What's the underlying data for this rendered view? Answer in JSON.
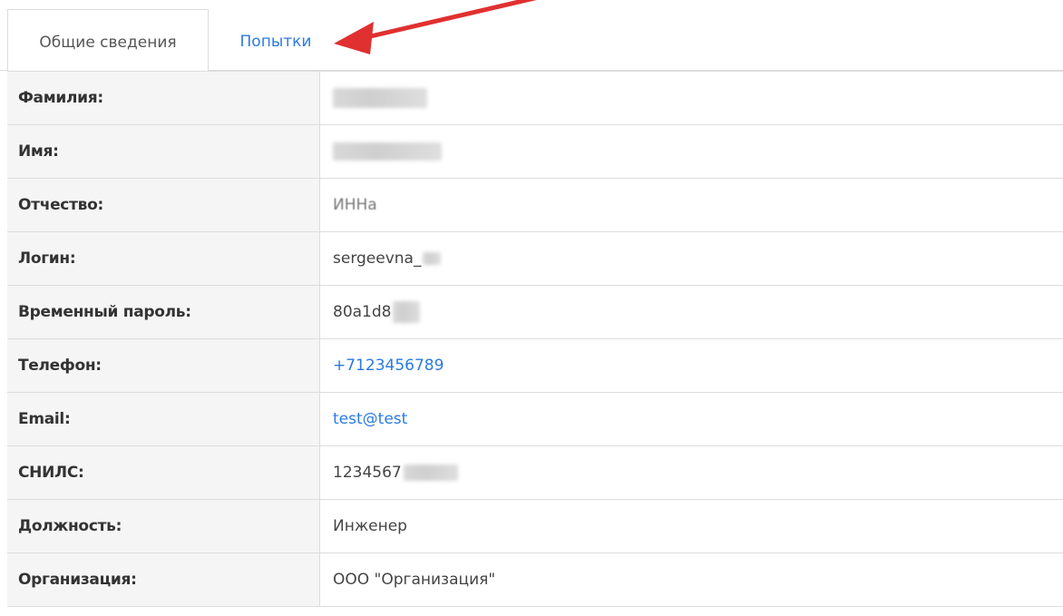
{
  "tabs": [
    {
      "label": "Общие сведения",
      "active": true
    },
    {
      "label": "Попытки",
      "active": false
    }
  ],
  "colors": {
    "accent": "#2a7ae2",
    "arrow": "#e03030",
    "label_bg": "#f5f5f5",
    "border": "#dddddd"
  },
  "fields": [
    {
      "label": "Фамилия:",
      "value": ""
    },
    {
      "label": "Имя:",
      "value": ""
    },
    {
      "label": "Отчество:",
      "value": "ИННа"
    },
    {
      "label": "Логин:",
      "value": "sergeevna_"
    },
    {
      "label": "Временный пароль:",
      "value": "80a1d8"
    },
    {
      "label": "Телефон:",
      "value": "+7123456789"
    },
    {
      "label": "Email:",
      "value": "test@test"
    },
    {
      "label": "СНИЛС:",
      "value": "1234567"
    },
    {
      "label": "Должность:",
      "value": "Инженер"
    },
    {
      "label": "Организация:",
      "value": "ООО \"Организация\""
    }
  ]
}
